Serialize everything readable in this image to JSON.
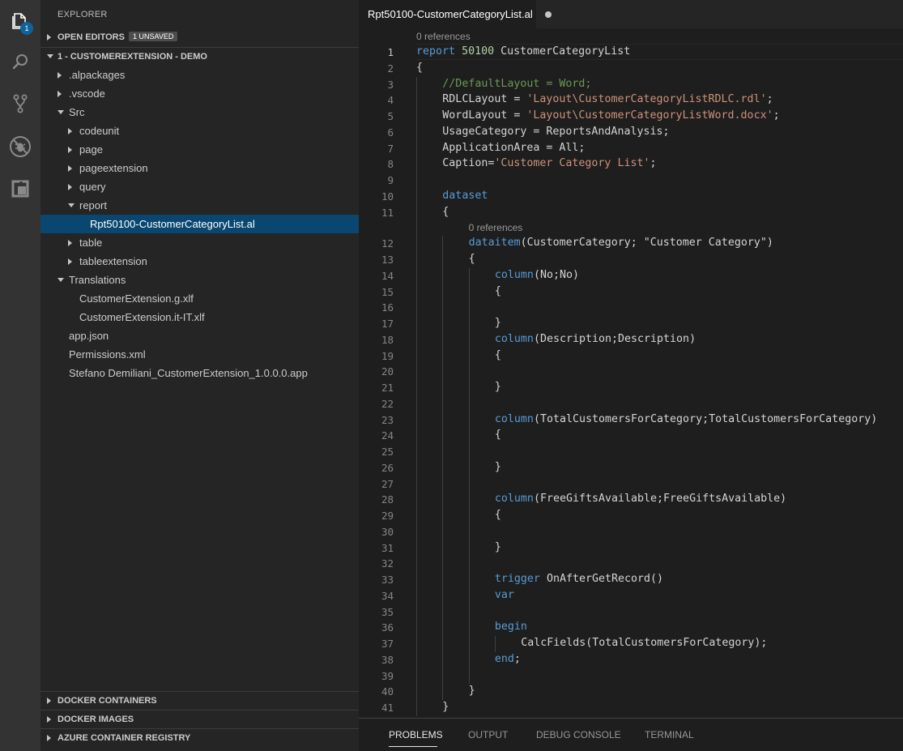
{
  "activity_bar": {
    "items": [
      {
        "icon": "files-icon",
        "badge": "1"
      },
      {
        "icon": "search-icon"
      },
      {
        "icon": "source-control-icon"
      },
      {
        "icon": "debug-icon"
      },
      {
        "icon": "extensions-icon"
      }
    ]
  },
  "sidebar": {
    "title": "EXPLORER",
    "open_editors": {
      "label": "OPEN EDITORS",
      "badge": "1 UNSAVED"
    },
    "workspace": {
      "label": "1 - CUSTOMEREXTENSION - DEMO"
    },
    "tree": [
      {
        "label": ".alpackages",
        "depth": 1,
        "twisty": "closed"
      },
      {
        "label": ".vscode",
        "depth": 1,
        "twisty": "closed"
      },
      {
        "label": "Src",
        "depth": 1,
        "twisty": "open"
      },
      {
        "label": "codeunit",
        "depth": 2,
        "twisty": "closed"
      },
      {
        "label": "page",
        "depth": 2,
        "twisty": "closed"
      },
      {
        "label": "pageextension",
        "depth": 2,
        "twisty": "closed"
      },
      {
        "label": "query",
        "depth": 2,
        "twisty": "closed"
      },
      {
        "label": "report",
        "depth": 2,
        "twisty": "open"
      },
      {
        "label": "Rpt50100-CustomerCategoryList.al",
        "depth": 3,
        "twisty": "none",
        "selected": true
      },
      {
        "label": "table",
        "depth": 2,
        "twisty": "closed"
      },
      {
        "label": "tableextension",
        "depth": 2,
        "twisty": "closed"
      },
      {
        "label": "Translations",
        "depth": 1,
        "twisty": "open"
      },
      {
        "label": "CustomerExtension.g.xlf",
        "depth": 2,
        "twisty": "none"
      },
      {
        "label": "CustomerExtension.it-IT.xlf",
        "depth": 2,
        "twisty": "none"
      },
      {
        "label": "app.json",
        "depth": 1,
        "twisty": "none"
      },
      {
        "label": "Permissions.xml",
        "depth": 1,
        "twisty": "none"
      },
      {
        "label": "Stefano Demiliani_CustomerExtension_1.0.0.0.app",
        "depth": 1,
        "twisty": "none"
      }
    ],
    "bottom_sections": [
      {
        "label": "DOCKER CONTAINERS"
      },
      {
        "label": "DOCKER IMAGES"
      },
      {
        "label": "AZURE CONTAINER REGISTRY"
      }
    ]
  },
  "tab": {
    "label": "Rpt50100-CustomerCategoryList.al",
    "dirty": true
  },
  "editor": {
    "active_line": 1,
    "lenses": [
      {
        "before_line": 1,
        "text": "0 references",
        "indent": 0
      },
      {
        "before_line": 12,
        "text": "0 references",
        "indent": 2
      }
    ],
    "lines": [
      {
        "n": "1",
        "indent": 0,
        "tokens": [
          {
            "t": "report",
            "c": "kw"
          },
          {
            "t": " "
          },
          {
            "t": "50100",
            "c": "num"
          },
          {
            "t": " CustomerCategoryList"
          }
        ]
      },
      {
        "n": "2",
        "indent": 0,
        "tokens": [
          {
            "t": "{"
          }
        ]
      },
      {
        "n": "3",
        "indent": 1,
        "tokens": [
          {
            "t": "//DefaultLayout = Word;",
            "c": "cmt"
          }
        ]
      },
      {
        "n": "4",
        "indent": 1,
        "tokens": [
          {
            "t": "RDLCLayout = "
          },
          {
            "t": "'Layout\\CustomerCategoryListRDLC.rdl'",
            "c": "str"
          },
          {
            "t": ";"
          }
        ]
      },
      {
        "n": "5",
        "indent": 1,
        "tokens": [
          {
            "t": "WordLayout = "
          },
          {
            "t": "'Layout\\CustomerCategoryListWord.docx'",
            "c": "str"
          },
          {
            "t": ";"
          }
        ]
      },
      {
        "n": "6",
        "indent": 1,
        "tokens": [
          {
            "t": "UsageCategory = ReportsAndAnalysis;"
          }
        ]
      },
      {
        "n": "7",
        "indent": 1,
        "tokens": [
          {
            "t": "ApplicationArea = All;"
          }
        ]
      },
      {
        "n": "8",
        "indent": 1,
        "tokens": [
          {
            "t": "Caption="
          },
          {
            "t": "'Customer Category List'",
            "c": "str"
          },
          {
            "t": ";"
          }
        ]
      },
      {
        "n": "9",
        "indent": 1,
        "tokens": []
      },
      {
        "n": "10",
        "indent": 1,
        "tokens": [
          {
            "t": "dataset",
            "c": "kw"
          }
        ]
      },
      {
        "n": "11",
        "indent": 1,
        "tokens": [
          {
            "t": "{"
          }
        ]
      },
      {
        "n": "12",
        "indent": 2,
        "tokens": [
          {
            "t": "dataitem",
            "c": "kw"
          },
          {
            "t": "(CustomerCategory; \"Customer Category\")"
          }
        ]
      },
      {
        "n": "13",
        "indent": 2,
        "tokens": [
          {
            "t": "{"
          }
        ]
      },
      {
        "n": "14",
        "indent": 3,
        "tokens": [
          {
            "t": "column",
            "c": "kw"
          },
          {
            "t": "(No;No)"
          }
        ]
      },
      {
        "n": "15",
        "indent": 3,
        "tokens": [
          {
            "t": "{"
          }
        ]
      },
      {
        "n": "16",
        "indent": 3,
        "tokens": []
      },
      {
        "n": "17",
        "indent": 3,
        "tokens": [
          {
            "t": "}"
          }
        ]
      },
      {
        "n": "18",
        "indent": 3,
        "tokens": [
          {
            "t": "column",
            "c": "kw"
          },
          {
            "t": "(Description;Description)"
          }
        ]
      },
      {
        "n": "19",
        "indent": 3,
        "tokens": [
          {
            "t": "{"
          }
        ]
      },
      {
        "n": "20",
        "indent": 3,
        "tokens": []
      },
      {
        "n": "21",
        "indent": 3,
        "tokens": [
          {
            "t": "}"
          }
        ]
      },
      {
        "n": "22",
        "indent": 3,
        "tokens": []
      },
      {
        "n": "23",
        "indent": 3,
        "tokens": [
          {
            "t": "column",
            "c": "kw"
          },
          {
            "t": "(TotalCustomersForCategory;TotalCustomersForCategory)"
          }
        ]
      },
      {
        "n": "24",
        "indent": 3,
        "tokens": [
          {
            "t": "{"
          }
        ]
      },
      {
        "n": "25",
        "indent": 3,
        "tokens": []
      },
      {
        "n": "26",
        "indent": 3,
        "tokens": [
          {
            "t": "}"
          }
        ]
      },
      {
        "n": "27",
        "indent": 3,
        "tokens": []
      },
      {
        "n": "28",
        "indent": 3,
        "tokens": [
          {
            "t": "column",
            "c": "kw"
          },
          {
            "t": "(FreeGiftsAvailable;FreeGiftsAvailable)"
          }
        ]
      },
      {
        "n": "29",
        "indent": 3,
        "tokens": [
          {
            "t": "{"
          }
        ]
      },
      {
        "n": "30",
        "indent": 3,
        "tokens": []
      },
      {
        "n": "31",
        "indent": 3,
        "tokens": [
          {
            "t": "}"
          }
        ]
      },
      {
        "n": "32",
        "indent": 3,
        "tokens": []
      },
      {
        "n": "33",
        "indent": 3,
        "tokens": [
          {
            "t": "trigger",
            "c": "kw"
          },
          {
            "t": " OnAfterGetRecord()"
          }
        ]
      },
      {
        "n": "34",
        "indent": 3,
        "tokens": [
          {
            "t": "var",
            "c": "kw"
          }
        ]
      },
      {
        "n": "35",
        "indent": 3,
        "tokens": []
      },
      {
        "n": "36",
        "indent": 3,
        "tokens": [
          {
            "t": "begin",
            "c": "kw"
          }
        ]
      },
      {
        "n": "37",
        "indent": 4,
        "tokens": [
          {
            "t": "CalcFields(TotalCustomersForCategory);"
          }
        ]
      },
      {
        "n": "38",
        "indent": 3,
        "tokens": [
          {
            "t": "end",
            "c": "kw"
          },
          {
            "t": ";"
          }
        ]
      },
      {
        "n": "39",
        "indent": 3,
        "tokens": []
      },
      {
        "n": "40",
        "indent": 2,
        "tokens": [
          {
            "t": "}"
          }
        ]
      },
      {
        "n": "41",
        "indent": 1,
        "tokens": [
          {
            "t": "}"
          }
        ]
      }
    ]
  },
  "panel": {
    "tabs": [
      {
        "label": "PROBLEMS",
        "active": true
      },
      {
        "label": "OUTPUT"
      },
      {
        "label": "DEBUG CONSOLE"
      },
      {
        "label": "TERMINAL"
      }
    ]
  },
  "colors": {
    "activity_bg": "#333333",
    "sidebar_bg": "#252526",
    "editor_bg": "#1e1e1e",
    "selection": "#094771",
    "keyword": "#569cd6",
    "string": "#ce9178",
    "comment": "#6a9955",
    "number": "#b5cea8",
    "badge": "#0e639c"
  }
}
